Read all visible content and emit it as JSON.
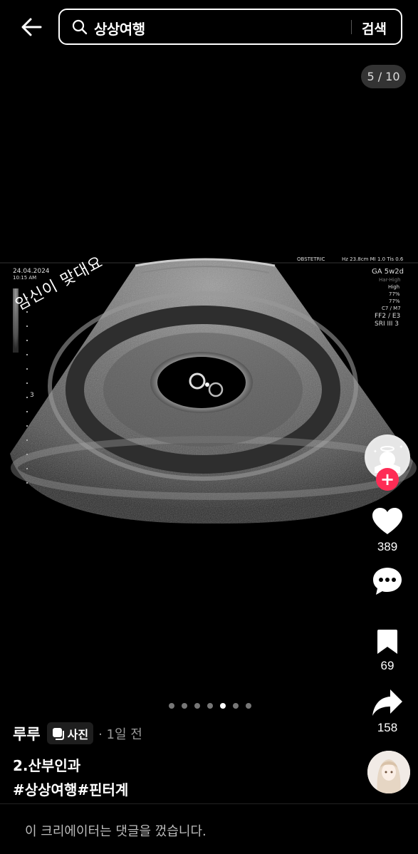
{
  "header": {
    "back_icon": "back-arrow-icon",
    "search_icon": "search-icon",
    "search_value": "상상여행",
    "search_button": "검색"
  },
  "media": {
    "page_counter": "5 / 10",
    "current_page": 5,
    "total_pages": 10,
    "ultrasound": {
      "date": "24.04.2024",
      "time": "10:15 AM",
      "mode": "OBSTETRIC",
      "params": "Hz 23.8cm MI 1.0 Tis 0.6",
      "ga": "GA 5w2d",
      "har": "Har-High",
      "high": "High",
      "pct1": "77%",
      "pct2": "77%",
      "c7m7": "C7 / M7",
      "ff2": "FF2 / E3",
      "sri": "SRI III 3",
      "scale_mark": "3"
    },
    "handwriting": "임신이 맞대요"
  },
  "actions": {
    "likes": "389",
    "comment_icon": "comment-bubble-icon",
    "bookmarks": "69",
    "shares": "158",
    "follow_symbol": "+"
  },
  "carousel": {
    "dot_count": 7,
    "active_index": 4
  },
  "post": {
    "author": "루루",
    "type_badge": "사진",
    "time": "· 1일 전",
    "title": "2.산부인과",
    "hashtags": [
      "#상상여행",
      "#핀터계"
    ]
  },
  "footer": {
    "comments_disabled": "이 크리에이터는 댓글을 껐습니다."
  },
  "colors": {
    "background": "#000000",
    "follow_accent": "#fe2c55",
    "text": "#ffffff"
  }
}
